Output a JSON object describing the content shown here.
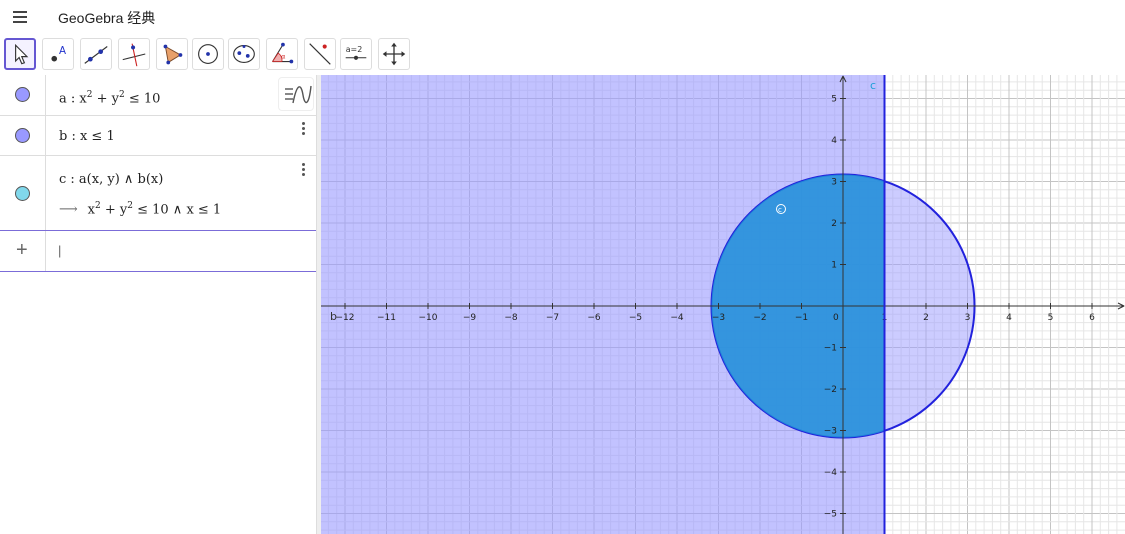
{
  "app": {
    "title": "GeoGebra 经典"
  },
  "toolbar": {
    "tools": [
      {
        "name": "move-tool",
        "active": true
      },
      {
        "name": "point-tool",
        "label": "A"
      },
      {
        "name": "line-tool"
      },
      {
        "name": "perpendicular-line-tool"
      },
      {
        "name": "polygon-tool"
      },
      {
        "name": "circle-center-point-tool"
      },
      {
        "name": "ellipse-tool"
      },
      {
        "name": "angle-tool"
      },
      {
        "name": "reflect-tool"
      },
      {
        "name": "slider-tool",
        "label": "a=2"
      },
      {
        "name": "move-graphics-view-tool"
      }
    ]
  },
  "algebra": {
    "rows": [
      {
        "name": "a",
        "color": "#9999ff",
        "def_prefix": "a : x",
        "def_mid": " + y",
        "def_suffix": " ≤ 10"
      },
      {
        "name": "b",
        "color": "#9999ff",
        "def": "b : x ≤ 1"
      },
      {
        "name": "c",
        "color": "#81d8eb",
        "def": "c : a(x, y) ∧ b(x)",
        "arrow": "⟶",
        "value_prefix": "x",
        "value_mid": " + y",
        "value_suffix": " ≤ 10 ∧ x ≤ 1"
      }
    ],
    "add_icon": "+",
    "input_placeholder": "|",
    "style_bar_icon": "style-bar-toggle-icon"
  },
  "graphics": {
    "object_labels": {
      "b": "b",
      "c": "c",
      "c_area": "c"
    },
    "colors": {
      "half_plane": "#9999ff",
      "disk": "#1e90d8",
      "boundary": "#2222dd",
      "axes": "#333333"
    },
    "x_ticks": [
      "−12",
      "−11",
      "−10",
      "−9",
      "−8",
      "−7",
      "−6",
      "−5",
      "−4",
      "−3",
      "−2",
      "−1",
      "0",
      "1",
      "2",
      "3",
      "4",
      "5",
      "6"
    ],
    "y_ticks": [
      "5",
      "4",
      "3",
      "2",
      "1",
      "−1",
      "−2",
      "−3",
      "−4",
      "−5"
    ]
  }
}
